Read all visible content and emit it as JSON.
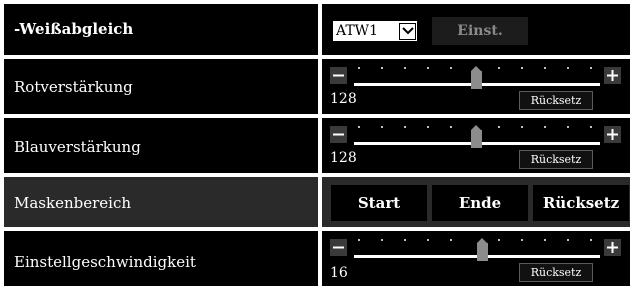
{
  "whitebalance": {
    "title": "-Weißabgleich",
    "mode_value": "ATW1",
    "set_button": "Einst."
  },
  "red_gain": {
    "label": "Rotverstärkung",
    "value": "128",
    "slider_fraction": 0.5,
    "reset": "Rücksetz"
  },
  "blue_gain": {
    "label": "Blauverstärkung",
    "value": "128",
    "slider_fraction": 0.5,
    "reset": "Rücksetz"
  },
  "mask_area": {
    "label": "Maskenbereich",
    "start": "Start",
    "end": "Ende",
    "reset": "Rücksetz"
  },
  "adjust_speed": {
    "label": "Einstellgeschwindigkeit",
    "value": "16",
    "slider_fraction": 0.52,
    "reset": "Rücksetz"
  },
  "icons": {
    "minus": "minus-icon",
    "plus": "plus-icon",
    "dropdown": "chevron-down-icon"
  }
}
